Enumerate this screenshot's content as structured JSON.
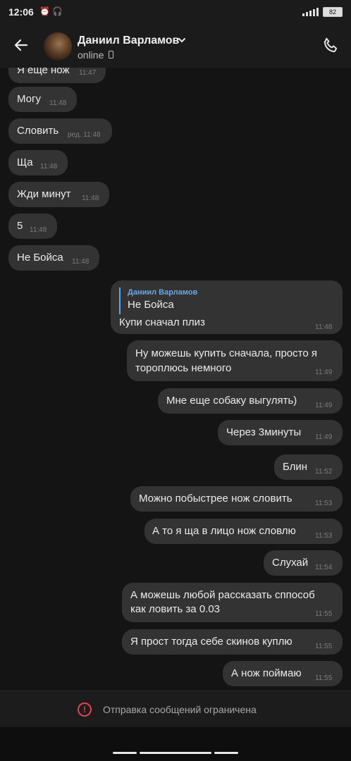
{
  "status_bar": {
    "time": "12:06",
    "left_icons": "⏰ 🎧",
    "battery": "82"
  },
  "header": {
    "contact_name": "Даниил Варламов",
    "status": "online"
  },
  "messages_in": [
    {
      "text": "Я еще нож",
      "time": "11:47"
    },
    {
      "text": "Могу",
      "time": "11:48"
    },
    {
      "text": "Словить",
      "time": "ред. 11:48"
    },
    {
      "text": "Ща",
      "time": "11:48"
    },
    {
      "text": "Жди минут",
      "time": "11:48"
    },
    {
      "text": "5",
      "time": "11:48"
    },
    {
      "text": "Не Бойса",
      "time": "11:48"
    }
  ],
  "reply_message": {
    "quote_author": "Даниил Варламов",
    "quote_text": "Не Бойса",
    "text": "Купи сначал плиз",
    "time": "11:48"
  },
  "messages_out": [
    {
      "line1": "Ну можешь купить сначала, просто я",
      "line2": "тороплюсь немного",
      "time": "11:49"
    },
    {
      "line1": "Мне еще собаку выгулять)",
      "time": "11:49"
    },
    {
      "line1": "Через 3минуты",
      "time": "11:49"
    },
    {
      "line1": "Блин",
      "time": "11:52"
    },
    {
      "line1": "Можно побыстрее нож словить",
      "time": "11:53"
    },
    {
      "line1": "А то я ща в лицо нож словлю",
      "time": "11:53"
    },
    {
      "line1": "Слухай",
      "time": "11:54"
    },
    {
      "line1": "А можешь любой рассказать сппособ",
      "line2": "как ловить за 0.03",
      "time": "11:55"
    },
    {
      "line1": "Я прост тогда себе скинов куплю",
      "time": "11:55"
    },
    {
      "line1": "А нож поймаю",
      "time": "11:55"
    }
  ],
  "footer": {
    "text": "Отправка сообщений ограничена"
  }
}
